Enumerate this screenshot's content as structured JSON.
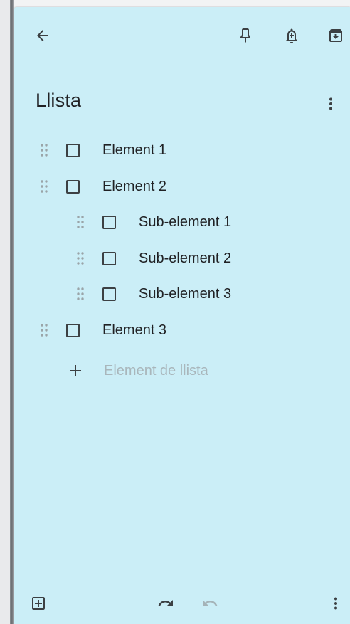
{
  "note": {
    "title": "Llista",
    "background_color": "#cbeef7",
    "icons": {
      "back": "arrow-back-icon",
      "pin": "pin-icon",
      "reminder": "reminder-bell-icon",
      "archive": "archive-icon",
      "more": "more-vert-icon",
      "add_box": "add-box-icon",
      "undo": "undo-icon",
      "redo": "redo-icon"
    },
    "items": [
      {
        "label": "Element 1",
        "checked": false,
        "level": 0
      },
      {
        "label": "Element 2",
        "checked": false,
        "level": 0
      },
      {
        "label": "Sub-element 1",
        "checked": false,
        "level": 1
      },
      {
        "label": "Sub-element 2",
        "checked": false,
        "level": 1
      },
      {
        "label": "Sub-element 3",
        "checked": false,
        "level": 1
      },
      {
        "label": "Element 3",
        "checked": false,
        "level": 0
      }
    ],
    "add_item_placeholder": "Element de llista",
    "redo_enabled": false
  }
}
